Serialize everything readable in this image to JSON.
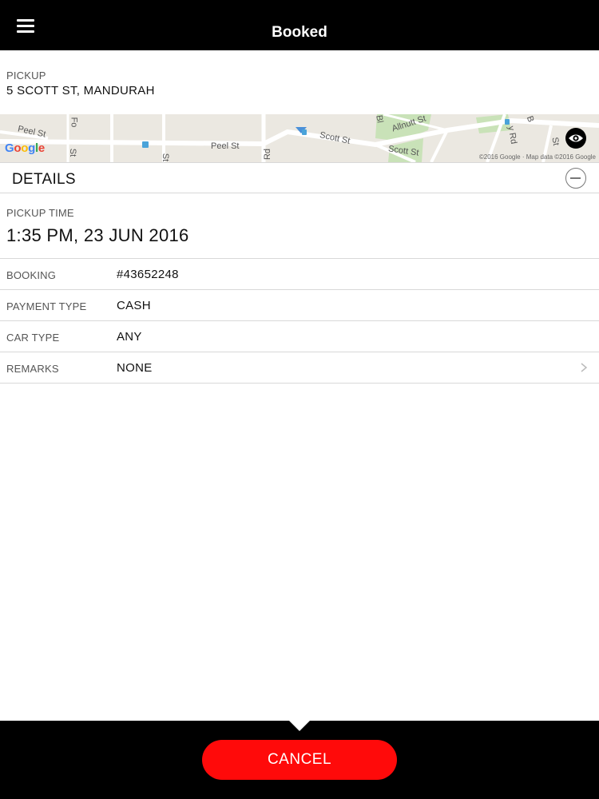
{
  "header": {
    "title": "Booked",
    "menu_icon": "hamburger-menu-icon"
  },
  "pickup": {
    "label": "PICKUP",
    "address": "5 SCOTT ST, MANDURAH"
  },
  "map": {
    "streets": [
      "Peel St",
      "Peel St",
      "Scott St",
      "Scott St",
      "Allnutt St",
      "Rd",
      "Fo",
      "St",
      "St",
      "Bl",
      "y Rd",
      "St",
      "B"
    ],
    "logo": "Google",
    "attribution": "©2016 Google · Map data ©2016 Google",
    "view_icon": "eye-icon"
  },
  "details": {
    "title": "DETAILS",
    "collapse_icon": "minus-circle-icon"
  },
  "pickup_time": {
    "label": "PICKUP TIME",
    "value": "1:35 PM, 23 JUN 2016"
  },
  "rows": [
    {
      "label": "BOOKING",
      "value": "#43652248"
    },
    {
      "label": "PAYMENT TYPE",
      "value": "CASH"
    },
    {
      "label": "CAR TYPE",
      "value": "ANY"
    },
    {
      "label": "REMARKS",
      "value": "NONE"
    }
  ],
  "footer": {
    "cancel_label": "CANCEL"
  },
  "colors": {
    "header_bg": "#000000",
    "cancel_bg": "#ff0a0a",
    "map_bg": "#ebe8e1",
    "divider": "#d8d8d8"
  }
}
